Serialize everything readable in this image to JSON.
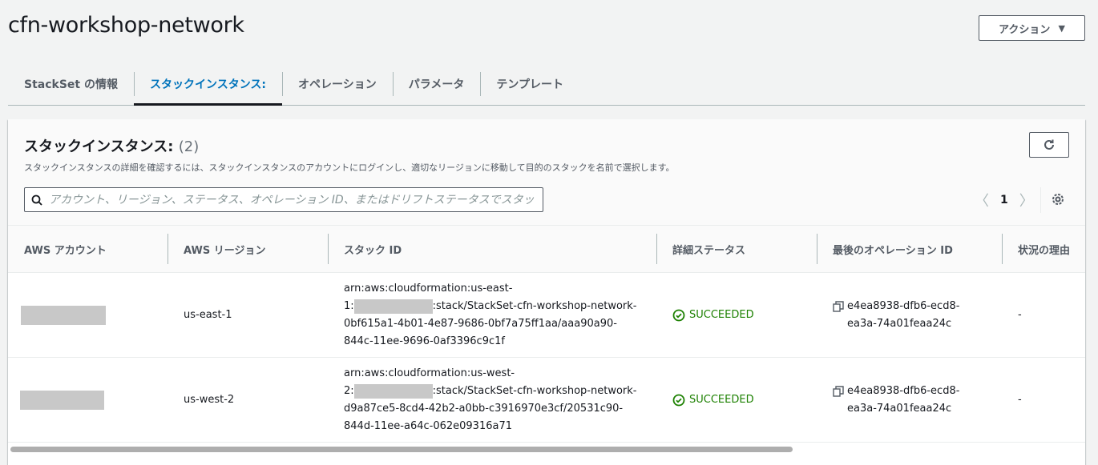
{
  "page": {
    "title": "cfn-workshop-network"
  },
  "actions": {
    "label": "アクション"
  },
  "tabs": [
    {
      "label": "StackSet の情報"
    },
    {
      "label": "スタックインスタンス:"
    },
    {
      "label": "オペレーション"
    },
    {
      "label": "パラメータ"
    },
    {
      "label": "テンプレート"
    }
  ],
  "panel": {
    "title": "スタックインスタンス:",
    "count": "(2)",
    "description": "スタックインスタンスの詳細を確認するには、スタックインスタンスのアカウントにログインし、適切なリージョンに移動して目的のスタックを名前で選択します。",
    "search_placeholder": "アカウント、リージョン、ステータス、オペレーション ID、またはドリフトステータスでスタッ",
    "page_number": "1"
  },
  "table": {
    "columns": [
      "AWS アカウント",
      "AWS リージョン",
      "スタック ID",
      "詳細ステータス",
      "最後のオペレーション ID",
      "状況の理由"
    ],
    "rows": [
      {
        "region": "us-east-1",
        "stack_id_l1": "arn:aws:cloudformation:us-east-",
        "stack_id_l2_pre": "1:",
        "stack_id_l2_post": ":stack/StackSet-cfn-workshop-network-",
        "stack_id_l3": "0bf615a1-4b01-4e87-9686-0bf7a75ff1aa/aaa90a90-",
        "stack_id_l4": "844c-11ee-9696-0af3396c9c1f",
        "status": "SUCCEEDED",
        "op_id_l1": "e4ea8938-dfb6-ecd8-",
        "op_id_l2": "ea3a-74a01feaa24c",
        "reason": "-"
      },
      {
        "region": "us-west-2",
        "stack_id_l1": "arn:aws:cloudformation:us-west-",
        "stack_id_l2_pre": "2:",
        "stack_id_l2_post": ":stack/StackSet-cfn-workshop-network-",
        "stack_id_l3": "d9a87ce5-8cd4-42b2-a0bb-c3916970e3cf/20531c90-",
        "stack_id_l4": "844d-11ee-a64c-062e09316a71",
        "status": "SUCCEEDED",
        "op_id_l1": "e4ea8938-dfb6-ecd8-",
        "op_id_l2": "ea3a-74a01feaa24c",
        "reason": "-"
      }
    ]
  },
  "colors": {
    "accent": "#0073bb",
    "success": "#1d8102",
    "border": "#545b64"
  }
}
